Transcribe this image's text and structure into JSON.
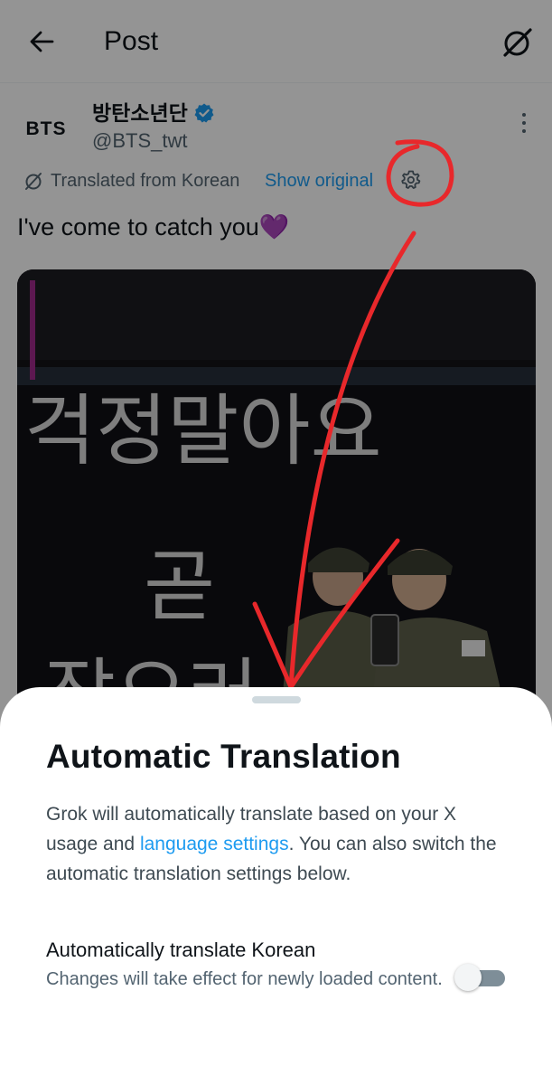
{
  "header": {
    "title": "Post",
    "back_icon": "arrow-left-icon",
    "grok_icon": "grok-translate-icon"
  },
  "post": {
    "author_avatar_text": "BTS",
    "author_name": "방탄소년단",
    "handle": "@BTS_twt",
    "verified_color": "#1d9bf0",
    "translated_label": "Translated from Korean",
    "show_original_label": "Show original",
    "text": "I've come to catch you💜",
    "media": {
      "line1": "걱정말아요",
      "line2": "곧",
      "line3": "잡으러"
    }
  },
  "sheet": {
    "title": "Automatic Translation",
    "desc_before": "Grok will automatically translate based on your X usage and ",
    "desc_link": "language settings",
    "desc_after": ". You can also switch the automatic translation settings below.",
    "setting_label": "Automatically translate Korean",
    "setting_sub": "Changes will take effect for newly loaded content.",
    "toggle_on": false
  },
  "colors": {
    "accent": "#1d9bf0",
    "annotation": "#e8282b"
  }
}
